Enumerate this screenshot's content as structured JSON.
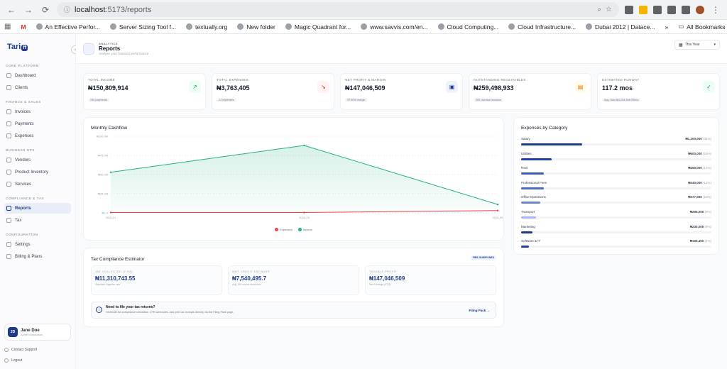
{
  "browser": {
    "url_host": "localhost",
    "url_path": ":5173/reports",
    "bookmarks": [
      "An Effective Perfor...",
      "Server Sizing Tool f...",
      "textually.org",
      "New folder",
      "Magic Quadrant for...",
      "www.savvis.com/en...",
      "Cloud Computing...",
      "Cloud Infrastructure...",
      "Dubai 2012 | Datace..."
    ],
    "all_bookmarks": "All Bookmarks"
  },
  "sidebar": {
    "logo": "Tari",
    "logo_badge": "ff",
    "sections": [
      {
        "title": "CORE PLATFORM",
        "items": [
          "Dashboard",
          "Clients"
        ]
      },
      {
        "title": "FINANCE & SALES",
        "items": [
          "Invoices",
          "Payments",
          "Expenses"
        ]
      },
      {
        "title": "BUSINESS OPS",
        "items": [
          "Vendors",
          "Product Inventory",
          "Services"
        ]
      },
      {
        "title": "COMPLIANCE & TAX",
        "items": [
          "Reports",
          "Tax"
        ]
      },
      {
        "title": "CONFIGURATION",
        "items": [
          "Settings",
          "Billing & Plans"
        ]
      }
    ],
    "active": "Reports",
    "user": {
      "initials": "JD",
      "name": "Jane Doe",
      "company": "Acme corporation"
    },
    "contact": "Contact Support",
    "logout": "Logout"
  },
  "header": {
    "kicker": "ANALYTICS",
    "title": "Reports",
    "subtitle": "Analyse your financial performance",
    "period": "This Year"
  },
  "cards": [
    {
      "label": "TOTAL INCOME",
      "value": "₦150,809,914",
      "sub": "249 payments",
      "icon": "trend-up-icon",
      "color": "#16a34a",
      "bg": "#ecfdf3"
    },
    {
      "label": "TOTAL EXPENSES",
      "value": "₦3,763,405",
      "sub": "21 expenses",
      "icon": "trend-down-icon",
      "color": "#dc2626",
      "bg": "#fef2f2"
    },
    {
      "label": "NET PROFIT & MARGIN",
      "value": "₦147,046,509",
      "sub": "97.50% margin",
      "icon": "wallet-icon",
      "color": "#1e3a8a",
      "bg": "#eef2ff"
    },
    {
      "label": "OUTSTANDING RECEIVABLES",
      "value": "₦259,498,933",
      "sub": "261 overdue invoices",
      "icon": "invoice-icon",
      "color": "#d97706",
      "bg": "#fffbeb"
    },
    {
      "label": "ESTIMATED RUNWAY",
      "value": "117.2 mos",
      "sub": "Avg. burn ₦1,254,468.33/mo",
      "icon": "check-circle-icon",
      "color": "#16a34a",
      "bg": "#ecfdf3"
    }
  ],
  "cashflow": {
    "title": "Monthly Cashflow",
    "yticks": [
      "₦100.0M",
      "₦75.0M",
      "₦50.0M",
      "₦25.0M",
      "₦0.0"
    ],
    "xticks": [
      "2026-01",
      "2026-03",
      "2026-05"
    ],
    "legend_expenses": "Expenses",
    "legend_income": "Income"
  },
  "chart_data": {
    "type": "area",
    "title": "Monthly Cashflow",
    "x": [
      "2026-01",
      "2026-03",
      "2026-05"
    ],
    "series": [
      {
        "name": "Income",
        "values": [
          53.0,
          88.0,
          11.0
        ],
        "color": "#22b07d"
      },
      {
        "name": "Expenses",
        "values": [
          0.5,
          0.5,
          3.0
        ],
        "color": "#ef4444"
      }
    ],
    "ylim": [
      0,
      100
    ],
    "unit": "₦M",
    "legend": "bottom",
    "grid": true
  },
  "expenses": {
    "title": "Expenses by Category",
    "items": [
      {
        "name": "Salary",
        "value": "₦1,200,000",
        "pct": "(32%)",
        "fraction": 0.32,
        "color": "#1e3a8a"
      },
      {
        "name": "Utilities",
        "value": "₦600,000",
        "pct": "(16%)",
        "fraction": 0.16,
        "color": "#1e40af"
      },
      {
        "name": "Rent",
        "value": "₦450,000",
        "pct": "(12%)",
        "fraction": 0.12,
        "color": "#3b5bb5"
      },
      {
        "name": "Professional Fees",
        "value": "₦440,000",
        "pct": "(12%)",
        "fraction": 0.12,
        "color": "#4a6bc4"
      },
      {
        "name": "Office Operations",
        "value": "₦377,005",
        "pct": "(10%)",
        "fraction": 0.1,
        "color": "#6b85cf"
      },
      {
        "name": "Transport",
        "value": "₦295,000",
        "pct": "(8%)",
        "fraction": 0.08,
        "color": "#a5b4fc"
      },
      {
        "name": "Marketing",
        "value": "₦230,000",
        "pct": "(6%)",
        "fraction": 0.06,
        "color": "#1e3a8a"
      },
      {
        "name": "Software & IT",
        "value": "₦165,400",
        "pct": "(4%)",
        "fraction": 0.04,
        "color": "#1e40af"
      }
    ]
  },
  "tax": {
    "title": "Tax Compliance Estimator",
    "badge": "FIRS GUIDELINES",
    "boxes": [
      {
        "label": "VAT COLLECTED (7.5%)",
        "value": "₦11,310,743.55",
        "note": "Standard Nigerian rate"
      },
      {
        "label": "WHT CREDIT ESTIMATE",
        "value": "₦7,540,495.7",
        "note": "Avg. 5% source deduction"
      },
      {
        "label": "TAXABLE PROFIT",
        "value": "₦147,046,509",
        "note": "Net Earnings (YTD)"
      }
    ],
    "info_title": "Need to file your tax returns?",
    "info_desc": "Generate full compliance checklists, CTR schedules, and print tax receipts directly via the Filing Pack page.",
    "info_link": "Filing Pack →"
  }
}
